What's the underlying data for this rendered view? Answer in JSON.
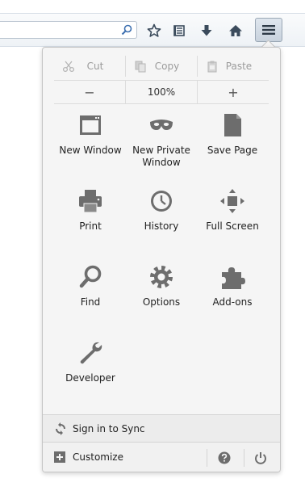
{
  "toolbar": {
    "search_value": "",
    "icons": [
      "search-icon",
      "bookmark-star-icon",
      "reading-list-icon",
      "downloads-icon",
      "home-icon",
      "hamburger-menu-icon"
    ]
  },
  "edit": {
    "cut": "Cut",
    "copy": "Copy",
    "paste": "Paste"
  },
  "zoom": {
    "out": "−",
    "level": "100%",
    "in": "+"
  },
  "tiles": [
    {
      "label": "New Window",
      "icon": "new-window-icon"
    },
    {
      "label": "New Private Window",
      "icon": "private-mask-icon"
    },
    {
      "label": "Save Page",
      "icon": "save-page-icon"
    },
    {
      "label": "Print",
      "icon": "printer-icon"
    },
    {
      "label": "History",
      "icon": "clock-icon"
    },
    {
      "label": "Full Screen",
      "icon": "fullscreen-arrows-icon"
    },
    {
      "label": "Find",
      "icon": "magnifier-icon"
    },
    {
      "label": "Options",
      "icon": "gear-icon"
    },
    {
      "label": "Add-ons",
      "icon": "puzzle-icon"
    },
    {
      "label": "Developer",
      "icon": "wrench-icon"
    }
  ],
  "sync": {
    "label": "Sign in to Sync"
  },
  "footer": {
    "customize": "Customize"
  },
  "colors": {
    "icon_gray": "#6d6d6d",
    "toolbar_icon": "#3b4b5c",
    "panel_bg": "#f5f5f5",
    "sync_bg": "#ececec"
  }
}
